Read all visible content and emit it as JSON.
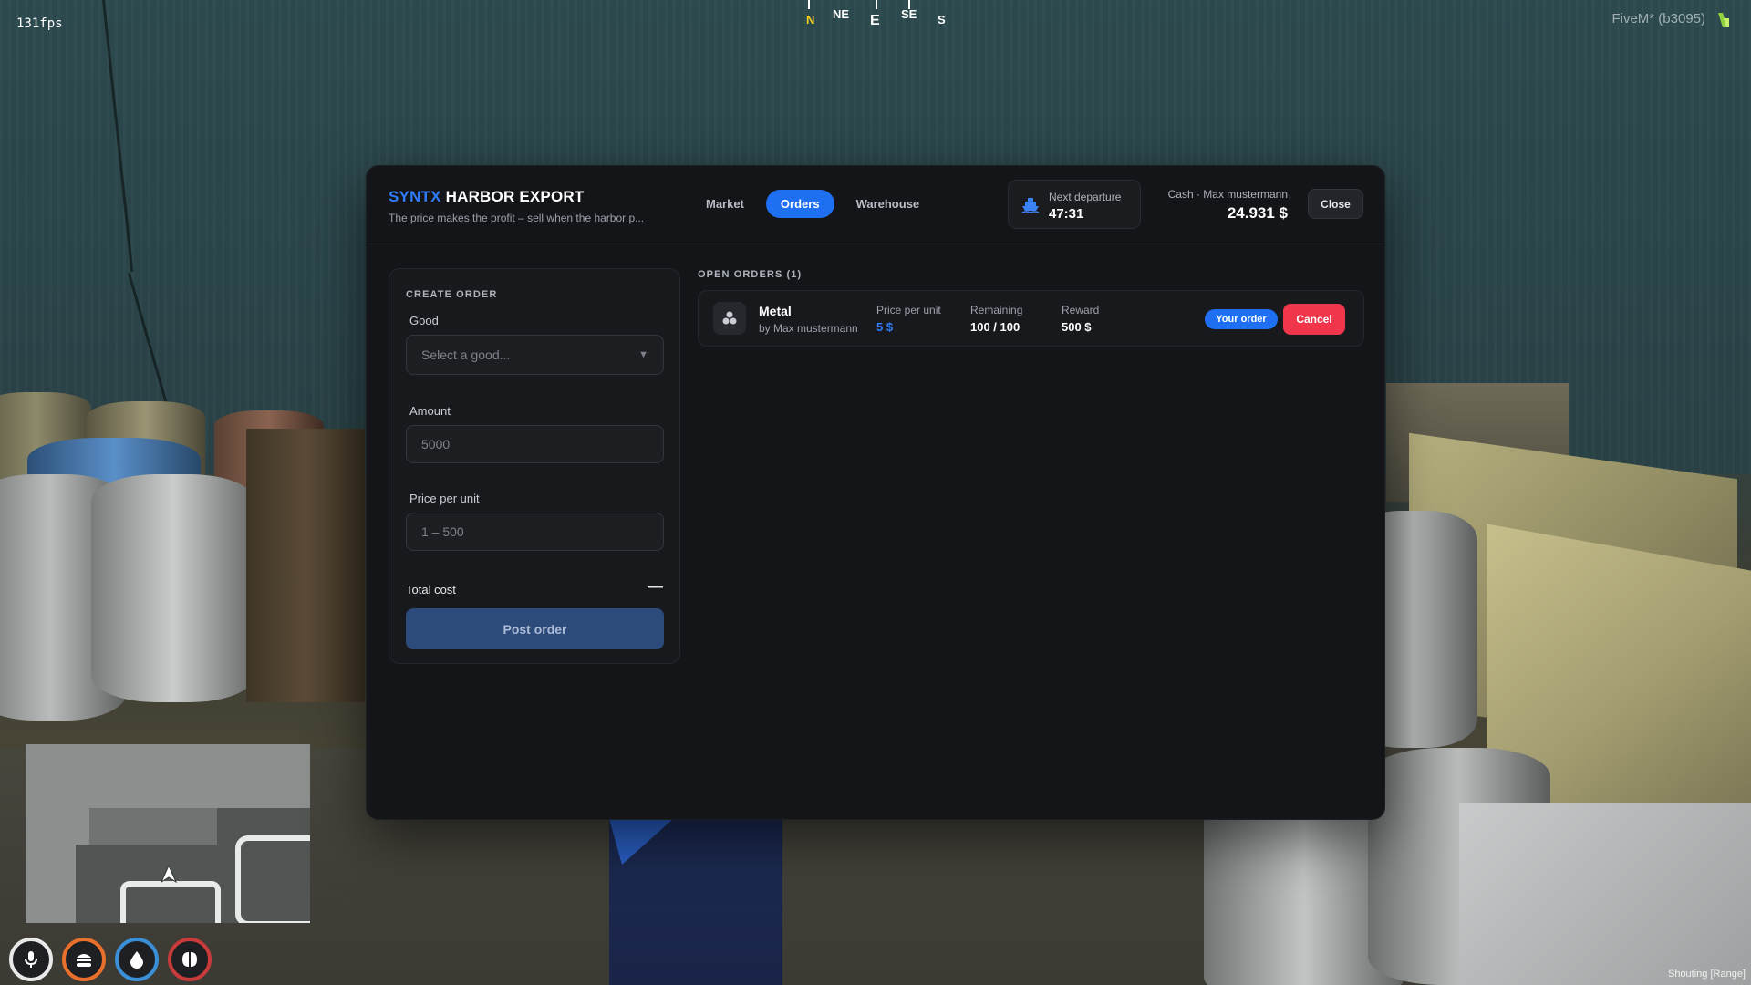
{
  "hud": {
    "fps": "131fps",
    "compass": [
      "N",
      "NE",
      "E",
      "SE",
      "S"
    ],
    "client": "FiveM* (b3095)",
    "voice_mode": "Shouting [Range]",
    "status_icons": [
      "microphone-icon",
      "food-icon",
      "water-icon",
      "stress-icon"
    ],
    "status_colors": [
      "#e8e8e8",
      "#e8702a",
      "#3a8fd6",
      "#c93a3a"
    ]
  },
  "header": {
    "brand_accent": "SYNTX",
    "brand_rest": "HARBOR EXPORT",
    "tagline": "The price makes the profit – sell when the harbor p...",
    "tabs": [
      "Market",
      "Orders",
      "Warehouse"
    ],
    "active_tab": "Orders",
    "departure_label": "Next departure",
    "departure_value": "47:31",
    "cash_label": "Cash · Max mustermann",
    "cash_value": "24.931 $",
    "close_label": "Close"
  },
  "create_order": {
    "title": "CREATE ORDER",
    "good_label": "Good",
    "good_placeholder": "Select a good...",
    "amount_label": "Amount",
    "amount_placeholder": "5000",
    "price_label": "Price per unit",
    "price_placeholder": "1 – 500",
    "total_label": "Total cost",
    "total_value": "—",
    "post_label": "Post order"
  },
  "open_orders": {
    "title": "OPEN ORDERS (1)",
    "rows": [
      {
        "good": "Metal",
        "by": "by Max mustermann",
        "price_label": "Price per unit",
        "price": "5 $",
        "remaining_label": "Remaining",
        "remaining": "100 / 100",
        "reward_label": "Reward",
        "reward": "500 $",
        "badge": "Your order",
        "cancel": "Cancel"
      }
    ]
  },
  "colors": {
    "accent": "#1e6ff2",
    "danger": "#f0364a",
    "panel": "#141518"
  }
}
